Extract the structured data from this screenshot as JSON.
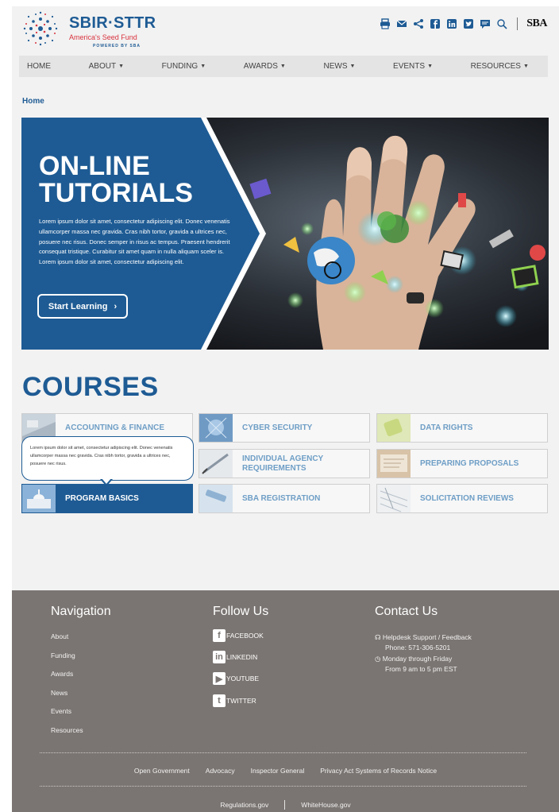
{
  "brand": {
    "title": "SBIR·STTR",
    "tagline": "America's Seed Fund",
    "powered": "POWERED BY SBA",
    "agency_logo": "SBA"
  },
  "utility_icons": [
    "print-icon",
    "mail-icon",
    "share-icon",
    "facebook-icon",
    "linkedin-icon",
    "twitter-icon",
    "chat-icon",
    "search-icon"
  ],
  "nav": [
    {
      "label": "HOME",
      "dropdown": false
    },
    {
      "label": "ABOUT",
      "dropdown": true
    },
    {
      "label": "FUNDING",
      "dropdown": true
    },
    {
      "label": "AWARDS",
      "dropdown": true
    },
    {
      "label": "NEWS",
      "dropdown": true
    },
    {
      "label": "EVENTS",
      "dropdown": true
    },
    {
      "label": "RESOURCES",
      "dropdown": true
    }
  ],
  "breadcrumb": "Home",
  "hero": {
    "title_line1": "ON-LINE",
    "title_line2": "TUTORIALS",
    "body": "Lorem ipsum dolor sit amet, consectetur adipiscing elit. Donec venenatis ullamcorper massa nec gravida. Cras nibh tortor, gravida a ultrices nec, posuere nec risus. Donec semper in risus ac tempus. Praesent hendrerit consequat tristique. Curabitur sit amet quam in nulla aliquam sceler is. Lorem ipsum dolor sit amet, consectetur adipiscing elit.",
    "cta": "Start Learning",
    "cta_icon": "chevron-right-icon"
  },
  "courses": {
    "heading": "COURSES",
    "items": [
      {
        "label": "ACCOUNTING & FINANCE"
      },
      {
        "label": "CYBER SECURITY"
      },
      {
        "label": "DATA RIGHTS"
      },
      {
        "label": "INDIVIDUAL AGENCY REQUIREMENTS"
      },
      {
        "label": "PREPARING PROPOSALS"
      },
      {
        "label": "PROGRAM BASICS"
      },
      {
        "label": "SBA REGISTRATION"
      },
      {
        "label": "SOLICITATION REVIEWS"
      }
    ],
    "tooltip": "Lorem ipsum dolor sit amet, consectetur adipiscing elit. Donec venenatis ullamcorper massa nec gravida. Cras nibh tortor, gravida a ultrices nec, posuere nec risus."
  },
  "footer": {
    "nav_title": "Navigation",
    "nav_links": [
      "About",
      "Funding",
      "Awards",
      "News",
      "Events",
      "Resources"
    ],
    "follow_title": "Follow Us",
    "social": [
      {
        "label": "FACEBOOK",
        "icon": "facebook-icon"
      },
      {
        "label": "LINKEDIN",
        "icon": "linkedin-icon"
      },
      {
        "label": "YOUTUBE",
        "icon": "youtube-icon"
      },
      {
        "label": "TWITTER",
        "icon": "twitter-icon"
      }
    ],
    "contact_title": "Contact Us",
    "contact_support": "Helpdesk Support / Feedback",
    "contact_phone": "Phone: 571-306-5201",
    "contact_days": "Monday through Friday",
    "contact_hours": "From 9 am to 5 pm EST",
    "links_row1": [
      "Open Government",
      "Advocacy",
      "Inspector General",
      "Privacy Act Systems of Records Notice"
    ],
    "links_row2": [
      "Regulations.gov",
      "WhiteHouse.gov"
    ]
  },
  "colors": {
    "brand_blue": "#1e5b94",
    "brand_red": "#d9333f",
    "footer_gray": "#7a7572",
    "course_text": "#6e9ec6"
  }
}
